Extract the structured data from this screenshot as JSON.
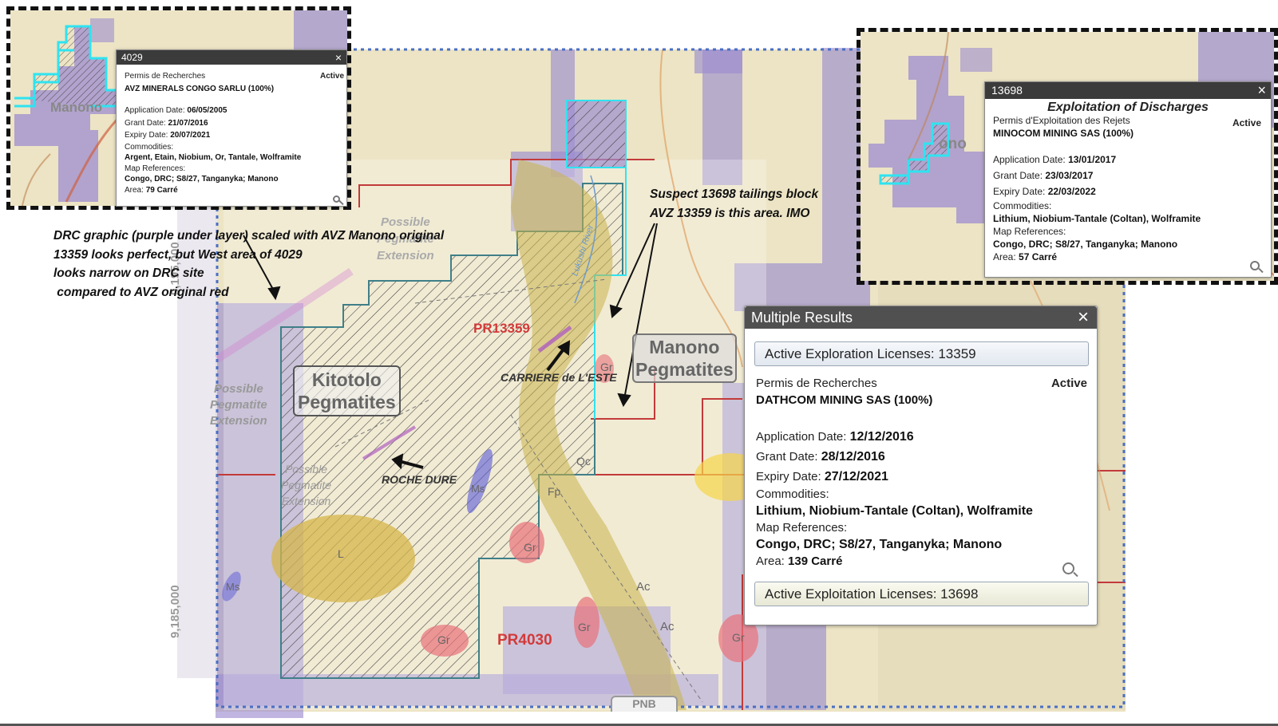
{
  "annotations": {
    "left_note": "DRC graphic (purple under layer) scaled with AVZ Manono original\n13359 looks perfect, but West area of 4029\nlooks narrow on DRC site\n compared to AVZ original red",
    "right_note": "Suspect 13698 tailings block\nAVZ 13359 is this area. IMO"
  },
  "map_labels": {
    "pr13359": "PR13359",
    "pr4030": "PR4030",
    "kitotolo": "Kitotolo\nPegmatites",
    "manono": "Manono\nPegmatites",
    "carriere": "CARRIERE de L'ESTE",
    "roche_dure": "ROCHE DURE",
    "possible_ext_top": "Possible\nPegmatite\nExtension",
    "possible_ext_left": "Possible\nPegmatite\nExtension",
    "possible_ext_center": "Possible\nPegmatite\nExtension",
    "lukushi_river": "Lukushi River",
    "coord_9195": "9,195,000",
    "coord_9185": "9,185,000",
    "geo_codes": [
      "Gr",
      "Gr",
      "Gr",
      "Gr",
      "Gr",
      "Ac",
      "Ac",
      "Qc",
      "Qc",
      "Fp",
      "Ms",
      "Ms",
      "L"
    ],
    "bottom_stub": "PNB"
  },
  "popup_4029": {
    "title": "4029",
    "close": "×",
    "permit_type": "Permis de Recherches",
    "status": "Active",
    "holder": "AVZ MINERALS CONGO SARLU (100%)",
    "app_date_label": "Application Date:",
    "app_date": "06/05/2005",
    "grant_date_label": "Grant Date:",
    "grant_date": "21/07/2016",
    "expiry_date_label": "Expiry Date:",
    "expiry_date": "20/07/2021",
    "commodities_label": "Commodities:",
    "commodities": "Argent, Etain, Niobium, Or, Tantale, Wolframite",
    "map_refs_label": "Map References:",
    "map_refs": "Congo, DRC; S8/27, Tanganyka; Manono",
    "area_label": "Area:",
    "area": "79 Carré",
    "inset_text": "Manono"
  },
  "popup_13698": {
    "title": "13698",
    "close": "×",
    "heading": "Exploitation of Discharges",
    "permit_type": "Permis d'Exploitation des Rejets",
    "status": "Active",
    "holder": "MINOCOM MINING SAS (100%)",
    "app_date_label": "Application Date:",
    "app_date": "13/01/2017",
    "grant_date_label": "Grant Date:",
    "grant_date": "23/03/2017",
    "expiry_date_label": "Expiry Date:",
    "expiry_date": "22/03/2022",
    "commodities_label": "Commodities:",
    "commodities": "Lithium, Niobium-Tantale (Coltan), Wolframite",
    "map_refs_label": "Map References:",
    "map_refs": "Congo, DRC; S8/27, Tanganyka; Manono",
    "area_label": "Area:",
    "area": "57 Carré",
    "inset_text": "ono"
  },
  "multiple_results": {
    "title": "Multiple Results",
    "close": "×",
    "exploration_bar": "Active Exploration Licenses: 13359",
    "permit_type": "Permis de Recherches",
    "status": "Active",
    "holder": "DATHCOM MINING SAS (100%)",
    "app_date_label": "Application Date:",
    "app_date": "12/12/2016",
    "grant_date_label": "Grant Date:",
    "grant_date": "28/12/2016",
    "expiry_date_label": "Expiry Date:",
    "expiry_date": "27/12/2021",
    "commodities_label": "Commodities:",
    "commodities": "Lithium, Niobium-Tantale (Coltan), Wolframite",
    "map_refs_label": "Map References:",
    "map_refs": "Congo, DRC; S8/27, Tanganyka; Manono",
    "area_label": "Area:",
    "area": "139 Carré",
    "exploitation_bar": "Active Exploitation Licenses: 13698"
  },
  "colors": {
    "terrain": "#ece4c4",
    "license_purple": "#9d8ed0",
    "hatched_block": "#5a5a5a",
    "license_border_red": "#c23a3a",
    "highlight_cyan": "#2fe3f0",
    "frame_blue": "#4a6fc4",
    "popup_header": "#3b3b3b"
  }
}
